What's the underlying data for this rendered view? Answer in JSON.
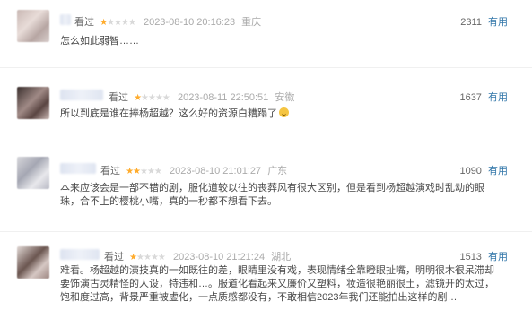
{
  "reviews": [
    {
      "watched": "看过",
      "stars": 1,
      "time": "2023-08-10 20:16:23",
      "location": "重庆",
      "votes": "2311",
      "useful": "有用",
      "text": "怎么如此弱智……"
    },
    {
      "watched": "看过",
      "stars": 1,
      "time": "2023-08-11 22:50:51",
      "location": "安徽",
      "votes": "1637",
      "useful": "有用",
      "text": "所以到底是谁在捧杨超越？这么好的资源白糟蹋了"
    },
    {
      "watched": "看过",
      "stars": 2,
      "time": "2023-08-10 21:01:27",
      "location": "广东",
      "votes": "1090",
      "useful": "有用",
      "text": "本来应该会是一部不错的剧，服化道较以往的丧葬风有很大区别，但是看到杨超越演戏时乱动的眼珠，合不上的樱桃小嘴，真的一秒都不想看下去。"
    },
    {
      "watched": "看过",
      "stars": 1,
      "time": "2023-08-10 21:21:24",
      "location": "湖北",
      "votes": "1513",
      "useful": "有用",
      "text": "难看。杨超越的演技真的一如既往的差，眼睛里没有戏，表现情绪全靠瞪眼扯嘴，明明很木很呆滞却要饰演古灵精怪的人设，特违和…。服道化看起来又廉价又塑料，妆造很艳丽很土，滤镜开的太过，饱和度过高，背景严重被虚化，一点质感都没有，不敢相信2023年我们还能拍出这样的剧…"
    }
  ]
}
